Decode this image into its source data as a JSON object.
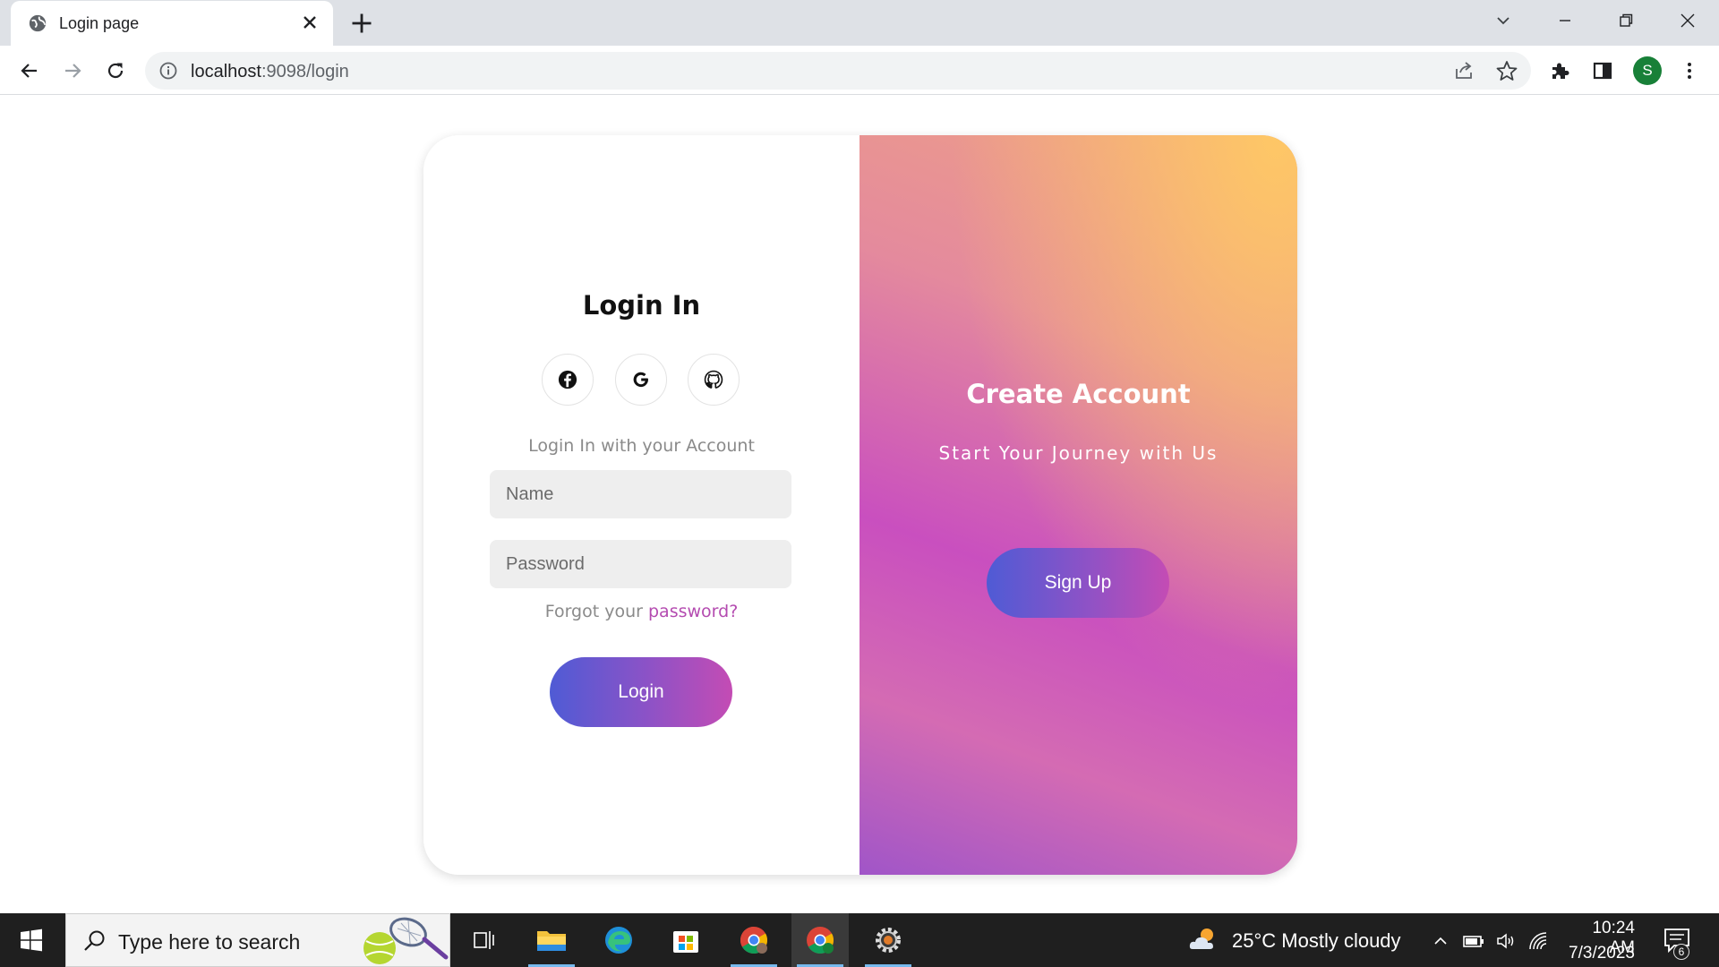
{
  "browser": {
    "tab_title": "Login page",
    "url_host": "localhost",
    "url_path": ":9098/login",
    "profile_initial": "S"
  },
  "login": {
    "title": "Login In",
    "social": [
      "facebook-icon",
      "google-icon",
      "github-icon"
    ],
    "subtitle": "Login In with your Account",
    "name_placeholder": "Name",
    "password_placeholder": "Password",
    "forgot_prefix": "Forgot your ",
    "forgot_link": "password?",
    "login_button": "Login"
  },
  "signup": {
    "title": "Create Account",
    "subtitle": "Start Your Journey with Us",
    "button": "Sign Up"
  },
  "taskbar": {
    "search_placeholder": "Type here to search",
    "weather": "25°C  Mostly cloudy",
    "time": "10:24 AM",
    "date": "7/3/2023",
    "notifications": "6"
  },
  "colors": {
    "accent_purple": "#b44bb0",
    "gradient_start": "#4f5bd5",
    "gradient_end": "#c44cb4",
    "panel_top": "#fec766",
    "panel_mid": "#c94fbf"
  }
}
